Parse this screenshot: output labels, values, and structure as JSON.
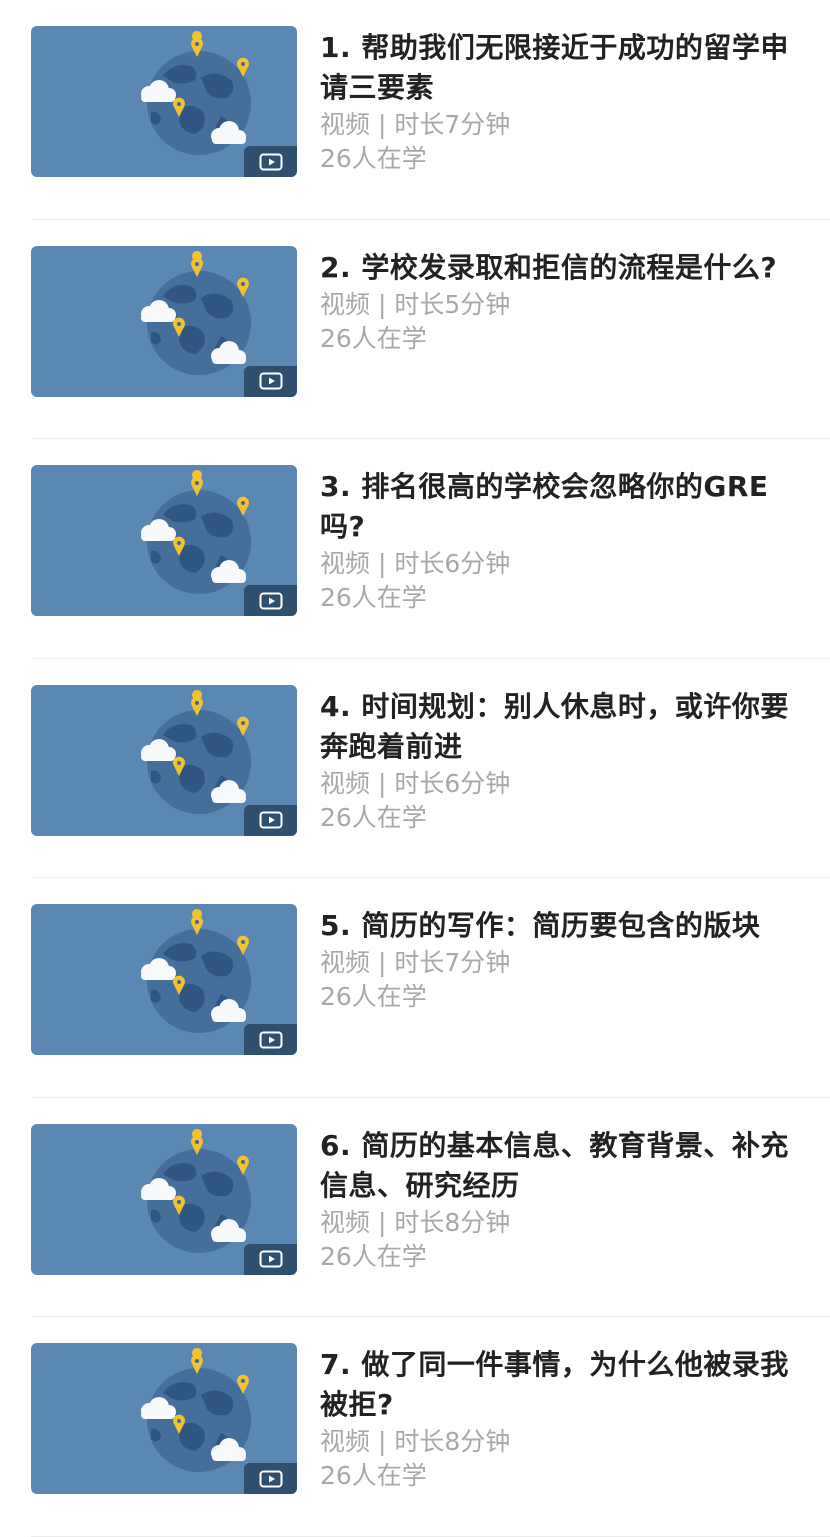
{
  "courses": [
    {
      "title": "1. 帮助我们无限接近于成功的留学申请三要素",
      "meta": "视频 | 时长7分钟",
      "learners": "26人在学"
    },
    {
      "title": "2. 学校发录取和拒信的流程是什么?",
      "meta": "视频 | 时长5分钟",
      "learners": "26人在学"
    },
    {
      "title": "3. 排名很高的学校会忽略你的GRE吗?",
      "meta": "视频 | 时长6分钟",
      "learners": "26人在学"
    },
    {
      "title": "4. 时间规划：别人休息时，或许你要奔跑着前进",
      "meta": "视频 | 时长6分钟",
      "learners": "26人在学"
    },
    {
      "title": "5. 简历的写作：简历要包含的版块",
      "meta": "视频 | 时长7分钟",
      "learners": "26人在学"
    },
    {
      "title": "6. 简历的基本信息、教育背景、补充信息、研究经历",
      "meta": "视频 | 时长8分钟",
      "learners": "26人在学"
    },
    {
      "title": "7. 做了同一件事情，为什么他被录我被拒?",
      "meta": "视频 | 时长8分钟",
      "learners": "26人在学"
    }
  ],
  "icons": {
    "thumbnail": "globe-illustration",
    "badge": "video-play-icon"
  },
  "colors": {
    "thumbnail_bg": "#5b88b3",
    "globe": "#3f6a94",
    "pin": "#f2c230",
    "title": "#222222",
    "meta": "#a8a8a8"
  }
}
